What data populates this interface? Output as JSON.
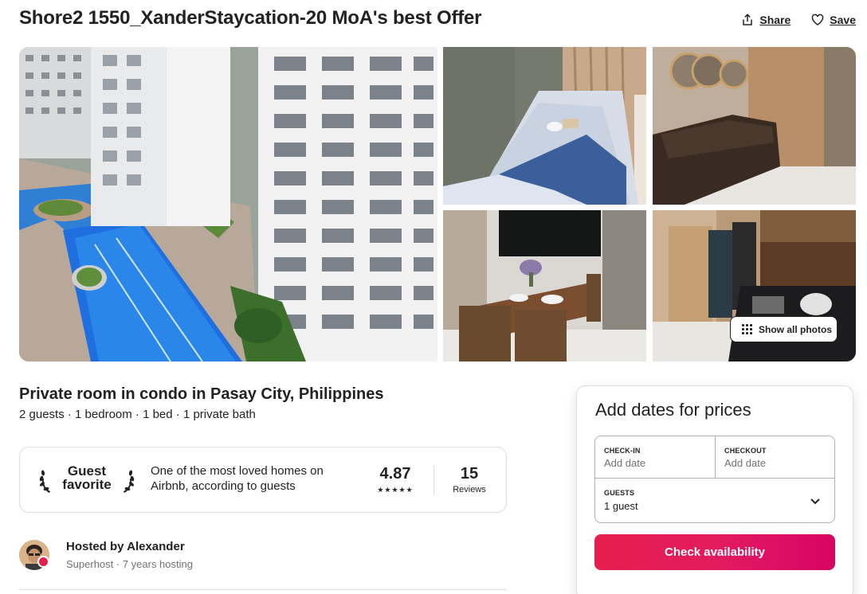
{
  "listing": {
    "title": "Shore2 1550_XanderStaycation-20 MoA's best Offer",
    "type": "Private room in condo in Pasay City, Philippines",
    "meta": "2 guests · 1 bedroom · 1 bed · 1 private bath"
  },
  "actions": {
    "share": "Share",
    "save": "Save"
  },
  "gallery": {
    "show_all": "Show all photos"
  },
  "guest_favorite": {
    "badge_line1": "Guest",
    "badge_line2": "favorite",
    "description": "One of the most loved homes on Airbnb, according to guests",
    "rating": "4.87",
    "stars": "★★★★★",
    "reviews_count": "15",
    "reviews_label": "Reviews"
  },
  "host": {
    "name": "Hosted by Alexander",
    "meta": "Superhost · 7 years hosting"
  },
  "booking": {
    "title": "Add dates for prices",
    "checkin_label": "CHECK-IN",
    "checkin_value": "Add date",
    "checkout_label": "CHECKOUT",
    "checkout_value": "Add date",
    "guests_label": "GUESTS",
    "guests_value": "1 guest",
    "cta": "Check availability"
  },
  "colors": {
    "brand": "#e61e4d",
    "text": "#222222",
    "muted": "#717171",
    "border": "#dddddd"
  }
}
